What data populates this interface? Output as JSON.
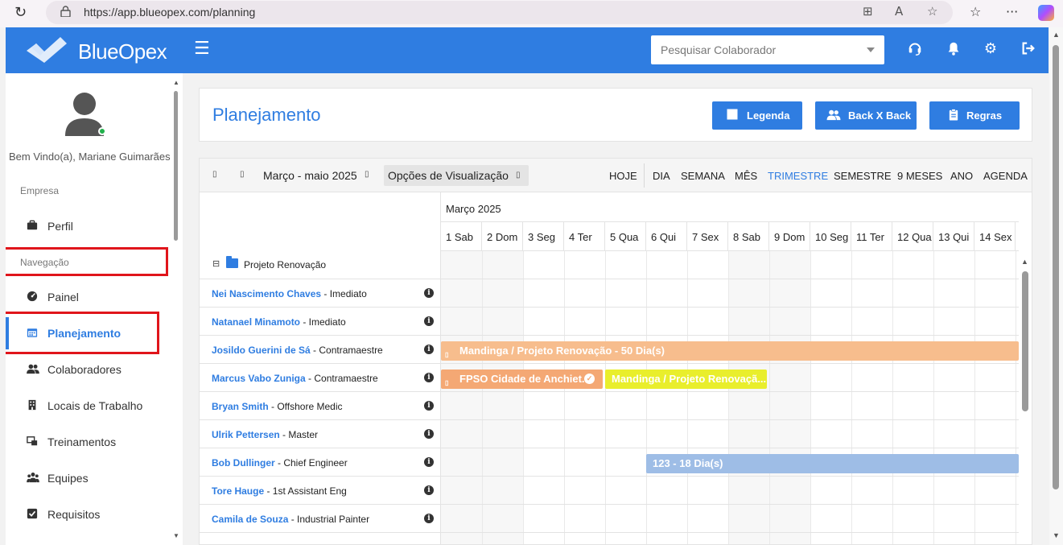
{
  "browser": {
    "url": "https://app.blueopex.com/planning"
  },
  "header": {
    "logo_text": "BlueOpex",
    "search_placeholder": "Pesquisar Colaborador"
  },
  "sidebar": {
    "welcome": "Bem Vindo(a), Mariane Guimarães",
    "section_empresa": "Empresa",
    "section_navegacao": "Navegação",
    "items": [
      {
        "label": "Perfil",
        "icon": "briefcase-icon"
      },
      {
        "label": "Painel",
        "icon": "dashboard-icon"
      },
      {
        "label": "Planejamento",
        "icon": "calendar-icon"
      },
      {
        "label": "Colaboradores",
        "icon": "users-icon"
      },
      {
        "label": "Locais de Trabalho",
        "icon": "building-icon"
      },
      {
        "label": "Treinamentos",
        "icon": "training-icon"
      },
      {
        "label": "Equipes",
        "icon": "team-icon"
      },
      {
        "label": "Requisitos",
        "icon": "checkbox-icon"
      }
    ]
  },
  "main": {
    "title": "Planejamento",
    "buttons": {
      "legenda": "Legenda",
      "backxback": "Back X Back",
      "regras": "Regras"
    }
  },
  "scheduler": {
    "range_label": "Março - maio 2025",
    "options_label": "Opções de Visualização",
    "views": [
      "HOJE",
      "DIA",
      "SEMANA",
      "MÊS",
      "TRIMESTRE",
      "SEMESTRE",
      "9 MESES",
      "ANO",
      "AGENDA"
    ],
    "selected_view": "TRIMESTRE",
    "month": "Março 2025",
    "days": [
      "1 Sab",
      "2 Dom",
      "3 Seg",
      "4 Ter",
      "5 Qua",
      "6 Qui",
      "7 Sex",
      "8 Sab",
      "9 Dom",
      "10 Seg",
      "11 Ter",
      "12 Qua",
      "13 Qui",
      "14 Sex"
    ],
    "group": "Projeto Renovação",
    "rows": [
      {
        "name": "Nei Nascimento Chaves",
        "role": " - Imediato"
      },
      {
        "name": "Natanael Minamoto",
        "role": " - Imediato"
      },
      {
        "name": "Josildo Guerini de Sá",
        "role": " - Contramaestre"
      },
      {
        "name": "Marcus Vabo Zuniga",
        "role": " - Contramaestre"
      },
      {
        "name": "Bryan Smith",
        "role": " - Offshore Medic"
      },
      {
        "name": "Ulrik Pettersen",
        "role": " - Master"
      },
      {
        "name": "Bob Dullinger",
        "role": " - Chief Engineer"
      },
      {
        "name": "Tore Hauge",
        "role": " - 1st Assistant Eng"
      },
      {
        "name": "Camila de Souza",
        "role": " - Industrial Painter"
      }
    ],
    "events": [
      {
        "label": "Mandinga / Projeto Renovação - 50 Dia(s)",
        "color": "#f7bd8d"
      },
      {
        "label": "FPSO Cidade de Anchiet...",
        "color": "#f4a874"
      },
      {
        "label": "Mandinga / Projeto Renovaçã...",
        "color": "#e9ee2c"
      },
      {
        "label": "123 - 18 Dia(s)",
        "color": "#9ebde6"
      }
    ]
  }
}
